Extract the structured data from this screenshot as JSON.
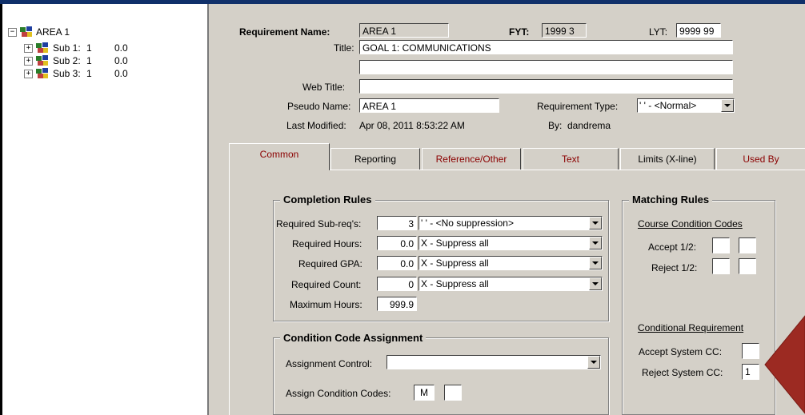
{
  "tree": {
    "root": {
      "label": "AREA 1"
    },
    "children": [
      {
        "label": "Sub 1:",
        "num": "1",
        "value": "0.0"
      },
      {
        "label": "Sub 2:",
        "num": "1",
        "value": "0.0"
      },
      {
        "label": "Sub 3:",
        "num": "1",
        "value": "0.0"
      }
    ]
  },
  "header": {
    "req_name_label": "Requirement Name:",
    "req_name": "AREA 1",
    "fyt_label": "FYT:",
    "fyt": "1999 3",
    "lyt_label": "LYT:",
    "lyt": "9999 99",
    "title_label": "Title:",
    "title": "GOAL 1:  COMMUNICATIONS",
    "title2": "",
    "web_title_label": "Web Title:",
    "web_title": "",
    "pseudo_label": "Pseudo Name:",
    "pseudo": "AREA 1",
    "req_type_label": "Requirement Type:",
    "req_type": "' ' - <Normal>",
    "last_modified_label": "Last Modified:",
    "last_modified": "Apr 08, 2011  8:53:22 AM",
    "by_label": "By:",
    "by": "dandrema"
  },
  "tabs": [
    {
      "label": "Common"
    },
    {
      "label": "Reporting"
    },
    {
      "label": "Reference/Other"
    },
    {
      "label": "Text"
    },
    {
      "label": "Limits (X-line)"
    },
    {
      "label": "Used By"
    }
  ],
  "completion": {
    "title": "Completion Rules",
    "rows": [
      {
        "label": "Required Sub-req's:",
        "value": "3",
        "option": "' ' - <No suppression>"
      },
      {
        "label": "Required Hours:",
        "value": "0.0",
        "option": "X - Suppress all"
      },
      {
        "label": "Required GPA:",
        "value": "0.0",
        "option": "X - Suppress all"
      },
      {
        "label": "Required Count:",
        "value": "0",
        "option": "X - Suppress all"
      }
    ],
    "max_hours_label": "Maximum Hours:",
    "max_hours": "999.9"
  },
  "condition": {
    "title": "Condition Code Assignment",
    "control_label": "Assignment Control:",
    "control": "",
    "assign_label": "Assign Condition Codes:",
    "code1": "M",
    "code2": ""
  },
  "matching": {
    "title": "Matching Rules",
    "course_cc": "Course Condition Codes",
    "accept_label": "Accept 1/2:",
    "accept1": "",
    "accept2": "",
    "reject_label": "Reject 1/2:",
    "reject1": "",
    "reject2": "",
    "cond_req": "Conditional Requirement",
    "accept_sys_label": "Accept System CC:",
    "accept_sys": "",
    "reject_sys_label": "Reject System CC:",
    "reject_sys": "1"
  },
  "colors": {
    "arrow": "#9c2a22",
    "tab_red": "#8b0000",
    "titlebar": "#10306a",
    "panel": "#d4d0c8"
  }
}
